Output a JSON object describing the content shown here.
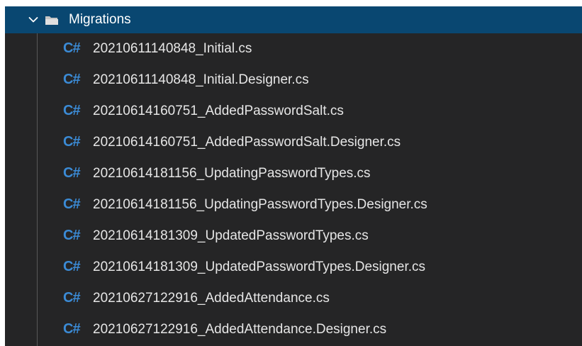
{
  "explorer": {
    "folder": {
      "name": "Migrations",
      "expanded": true,
      "chevron_icon": "chevron-down-icon",
      "folder_icon": "folder-open-icon"
    },
    "file_icon_text": "C#",
    "files": [
      {
        "name": "20210611140848_Initial.cs"
      },
      {
        "name": "20210611140848_Initial.Designer.cs"
      },
      {
        "name": "20210614160751_AddedPasswordSalt.cs"
      },
      {
        "name": "20210614160751_AddedPasswordSalt.Designer.cs"
      },
      {
        "name": "20210614181156_UpdatingPasswordTypes.cs"
      },
      {
        "name": "20210614181156_UpdatingPasswordTypes.Designer.cs"
      },
      {
        "name": "20210614181309_UpdatedPasswordTypes.cs"
      },
      {
        "name": "20210614181309_UpdatedPasswordTypes.Designer.cs"
      },
      {
        "name": "20210627122916_AddedAttendance.cs"
      },
      {
        "name": "20210627122916_AddedAttendance.Designer.cs"
      }
    ]
  },
  "colors": {
    "panel_background": "#252526",
    "selected_row": "#094771",
    "csharp_icon": "#3b8bd6",
    "file_text": "#e6e6e6",
    "indent_guide": "#585858"
  }
}
